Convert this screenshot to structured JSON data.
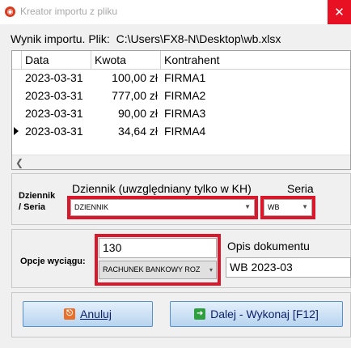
{
  "window": {
    "title": "Kreator importu z pliku",
    "close_glyph": "✕"
  },
  "import": {
    "label": "Wynik importu. Plik:",
    "path": "C:\\Users\\FX8-N\\Desktop\\wb.xlsx"
  },
  "grid": {
    "columns": [
      "Data",
      "Kwota",
      "Kontrahent"
    ],
    "rows": [
      {
        "date": "2023-03-31",
        "amount": "100,00 zł",
        "contractor": "FIRMA1"
      },
      {
        "date": "2023-03-31",
        "amount": "777,00 zł",
        "contractor": "FIRMA2"
      },
      {
        "date": "2023-03-31",
        "amount": "90,00 zł",
        "contractor": "FIRMA3"
      },
      {
        "date": "2023-03-31",
        "amount": "34,64 zł",
        "contractor": "FIRMA4"
      }
    ],
    "current_row_index": 3
  },
  "journal_section": {
    "side_label_line1": "Dziennik",
    "side_label_line2": "/ Seria",
    "journal_label": "Dziennik (uwzględniany tylko w KH)",
    "journal_value": "DZIENNIK",
    "series_label": "Seria",
    "series_value": "WB"
  },
  "statement_section": {
    "side_label": "Opcje wyciągu:",
    "number_value": "130",
    "account_value": "RACHUNEK BANKOWY ROZ",
    "doc_desc_label": "Opis dokumentu",
    "doc_desc_value": "WB 2023-03"
  },
  "buttons": {
    "cancel_label": "Anuluj",
    "next_label": "Dalej - Wykonaj [F12]"
  },
  "colors": {
    "highlight": "#d9182b",
    "close": "#e81123",
    "button_text": "#0b1f6b"
  }
}
